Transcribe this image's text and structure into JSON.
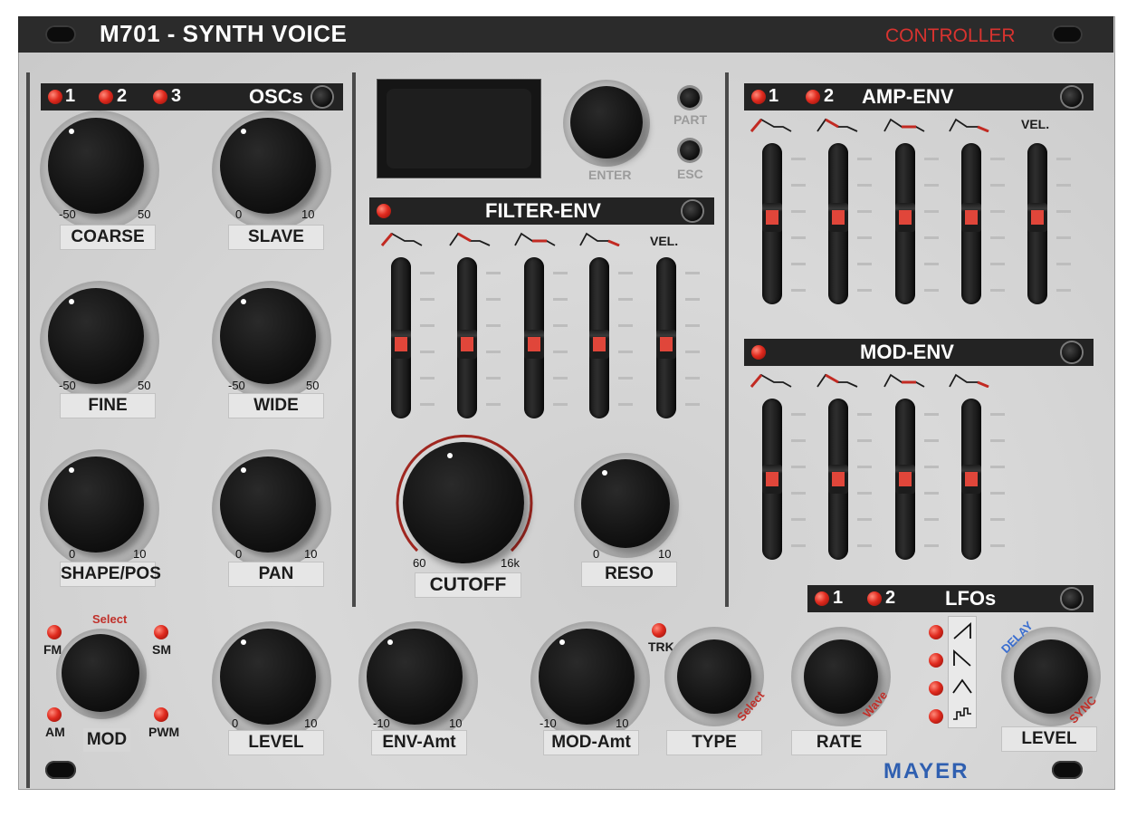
{
  "module": {
    "title": "M701 - SYNTH VOICE",
    "controller_label": "CONTROLLER",
    "brand": "MAYER"
  },
  "colors": {
    "panel": "#d0d0d0",
    "header_bar": "#232323",
    "accent_red": "#d8332f",
    "led_red": "#e02b1f",
    "brand_blue": "#2f5fb0"
  },
  "oscs": {
    "header": "OSCs",
    "leds": [
      "1",
      "2",
      "3"
    ],
    "knobs": {
      "coarse": {
        "label": "COARSE",
        "min": "-50",
        "max": "50"
      },
      "slave": {
        "label": "SLAVE",
        "min": "0",
        "max": "10"
      },
      "fine": {
        "label": "FINE",
        "min": "-50",
        "max": "50"
      },
      "wide": {
        "label": "WIDE",
        "min": "-50",
        "max": "50"
      },
      "shape": {
        "label": "SHAPE/POS",
        "min": "0",
        "max": "10"
      },
      "pan": {
        "label": "PAN",
        "min": "0",
        "max": "10"
      }
    }
  },
  "nav": {
    "part": "PART",
    "esc": "ESC",
    "enter": "ENTER"
  },
  "filter_env": {
    "header": "FILTER-ENV",
    "vel": "VEL.",
    "slider_levels": [
      0.45,
      0.45,
      0.45,
      0.45,
      0.45
    ]
  },
  "filter": {
    "cutoff": {
      "label": "CUTOFF",
      "min": "60",
      "max": "16k"
    },
    "reso": {
      "label": "RESO",
      "min": "0",
      "max": "10"
    }
  },
  "amp_env": {
    "header": "AMP-ENV",
    "leds": [
      "1",
      "2"
    ],
    "vel": "VEL.",
    "slider_levels": [
      0.55,
      0.55,
      0.55,
      0.55,
      0.55
    ]
  },
  "mod_env": {
    "header": "MOD-ENV",
    "slider_levels": [
      0.5,
      0.5,
      0.5,
      0.5
    ]
  },
  "lfos": {
    "header": "LFOs",
    "leds": [
      "1",
      "2"
    ],
    "waves": [
      "saw-up-icon",
      "saw-down-icon",
      "triangle-icon",
      "random-step-icon"
    ]
  },
  "bottom": {
    "mod": {
      "label": "MOD",
      "select": "Select",
      "fm": "FM",
      "sm": "SM",
      "am": "AM",
      "pwm": "PWM"
    },
    "level": {
      "label": "LEVEL",
      "min": "0",
      "max": "10"
    },
    "env_amt": {
      "label": "ENV-Amt",
      "min": "-10",
      "max": "10"
    },
    "mod_amt": {
      "label": "MOD-Amt",
      "min": "-10",
      "max": "10"
    },
    "trk": "TRK",
    "type": {
      "label": "TYPE",
      "select": "Select"
    },
    "rate": {
      "label": "RATE",
      "wave": "Wave"
    },
    "lfo_level": {
      "label": "LEVEL",
      "delay": "DELAY",
      "sync": "SYNC"
    }
  }
}
